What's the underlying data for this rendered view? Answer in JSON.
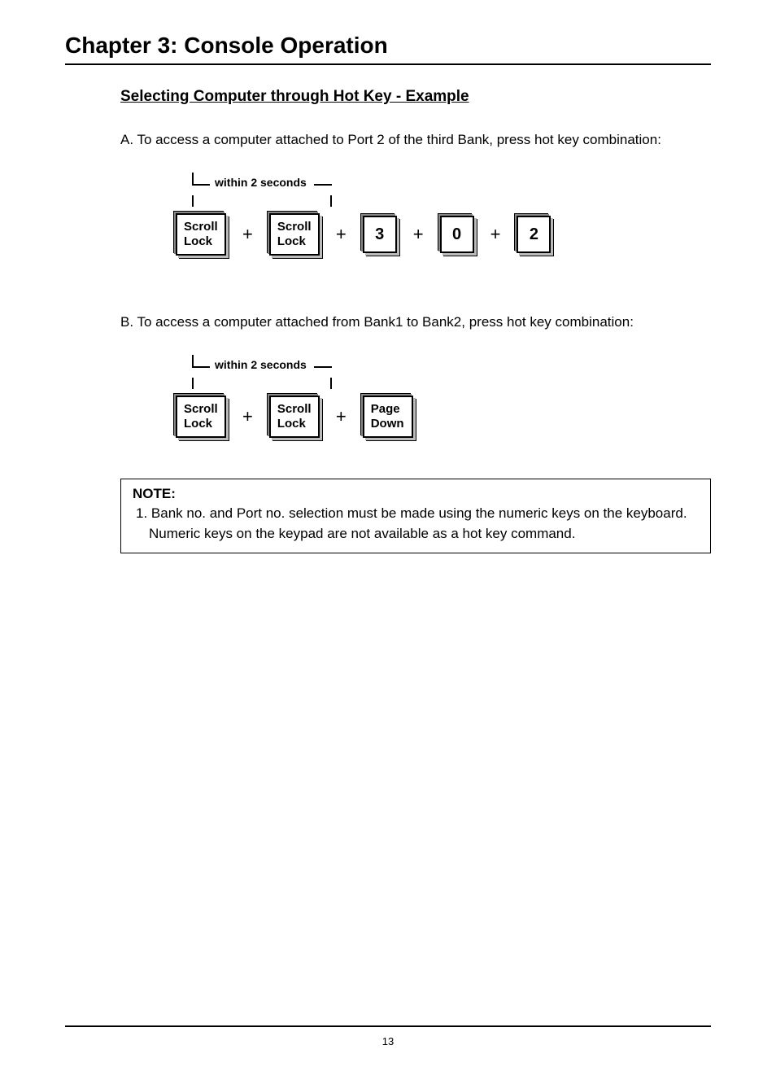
{
  "chapter_title": "Chapter 3: Console Operation",
  "section_title": "Selecting Computer through Hot Key - Example",
  "example_a": {
    "prefix": "A. ",
    "text": "To access a computer attached to Port 2 of the third Bank, press hot key combination:",
    "bracket_label": "within 2 seconds",
    "keys": [
      "Scroll Lock",
      "Scroll Lock",
      "3",
      "0",
      "2"
    ],
    "plus": "+"
  },
  "example_b": {
    "prefix": "B. ",
    "text": "To access a computer attached from Bank1 to Bank2, press hot key combination:",
    "bracket_label": "within 2 seconds",
    "keys": [
      "Scroll Lock",
      "Scroll Lock",
      "Page Down"
    ],
    "plus": "+"
  },
  "note": {
    "title": "NOTE:",
    "line1": "1. Bank no. and Port no. selection must be made using the numeric keys on the keyboard.",
    "line2": "Numeric keys on the keypad are not available as a hot key command."
  },
  "page_number": "13"
}
